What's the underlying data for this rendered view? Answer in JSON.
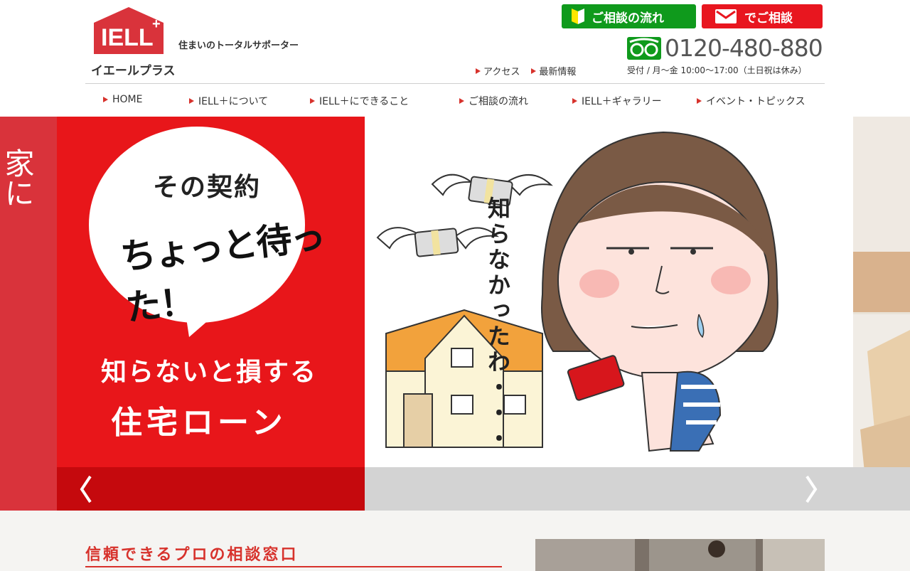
{
  "header": {
    "logo_wordmark": "IELL+",
    "logo_kana": "イエールプラス",
    "tagline": "住まいのトータルサポーター",
    "btn_flow": "ご相談の流れ",
    "btn_consult": "でご相談",
    "phone": "0120-480-880",
    "hours": "受付 / 月〜金 10:00〜17:00（土日祝は休み）",
    "sublinks": [
      "アクセス",
      "最新情報"
    ]
  },
  "nav": {
    "items": [
      "HOME",
      "IELL＋について",
      "IELL＋にできること",
      "ご相談の流れ",
      "IELL＋ギャラリー",
      "イベント・トピックス"
    ]
  },
  "hero": {
    "peek_text": "家に",
    "bubble_line1": "その契約",
    "bubble_line2": "ちょっと待った！",
    "line1": "知らないと損する",
    "line2": "住宅ローン",
    "side_text": "知らなかったわ・・・"
  },
  "section": {
    "title": "信頼できるプロの相談窓口"
  },
  "colors": {
    "accent_red": "#e8161a",
    "green": "#0f9a1c",
    "title_red": "#d7322c"
  }
}
